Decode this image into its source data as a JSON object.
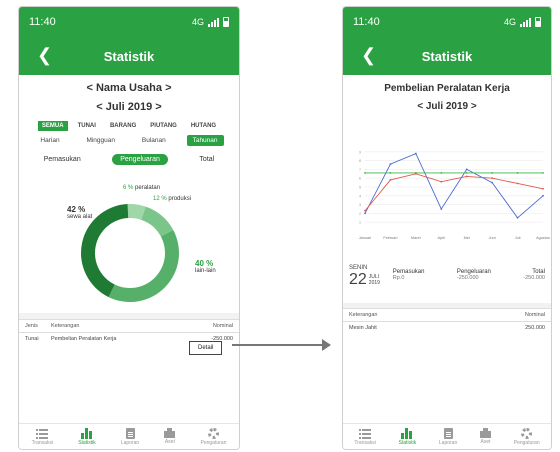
{
  "status": {
    "time": "11:40",
    "network": "4G"
  },
  "colors": {
    "brand_green": "#2aa142",
    "blue_line": "#4a6bd6",
    "red_line": "#e05a4a",
    "green_line": "#3db54a"
  },
  "screen1": {
    "title": "Statistik",
    "business_selector": "< Nama Usaha >",
    "month_selector": "< Juli 2019 >",
    "type_tabs": [
      "SEMUA",
      "TUNAI",
      "BARANG",
      "PIUTANG",
      "HUTANG"
    ],
    "period_filters": [
      "Harian",
      "Mingguan",
      "Bulanan",
      "Tahunan"
    ],
    "segments": [
      "Pemasukan",
      "Pengeluaran",
      "Total"
    ],
    "donut": {
      "slices": [
        {
          "label": "42 %",
          "sub": "sewa alat",
          "value": 42,
          "color": "#1f7a33"
        },
        {
          "label": "6 %",
          "sub": "peralatan",
          "value": 6,
          "color": "#9fd7a8"
        },
        {
          "label": "12 %",
          "sub": "produksi",
          "value": 12,
          "color": "#7cc58a"
        },
        {
          "label": "40 %",
          "sub": "lain-lain",
          "value": 40,
          "color": "#56b06a"
        }
      ]
    },
    "table": {
      "headers": [
        "Jenis",
        "Keterangan",
        "Nominal"
      ],
      "rows": [
        {
          "jenis": "Tunai",
          "keterangan": "Pembelian Peralatan Kerja",
          "nominal": "-250.000"
        }
      ]
    },
    "detail_button": "Detail"
  },
  "screen2": {
    "title": "Statistik",
    "heading": "Pembelian Peralatan Kerja",
    "month_selector": "< Juli 2019 >",
    "summary": {
      "day_label": "SENIN",
      "day": "22",
      "month_year": "JULI 2019",
      "cols": [
        {
          "label": "Pemasukan",
          "value": "Rp.0"
        },
        {
          "label": "Pengeluaran",
          "value": "-250.000"
        },
        {
          "label": "Total",
          "value": "-250.000"
        }
      ]
    },
    "table": {
      "headers": [
        "Keterangan",
        "Nominal"
      ],
      "rows": [
        {
          "keterangan": "Mesin Jahit",
          "nominal": "250.000"
        }
      ]
    }
  },
  "bottom_nav": [
    "Transaksi",
    "Statistik",
    "Laporan",
    "Aset",
    "Pengaturan"
  ],
  "chart_data": {
    "type": "line",
    "title": "",
    "x": [
      "Januari",
      "Februari",
      "Maret",
      "April",
      "Mei",
      "Juni",
      "Juli",
      "Agustus"
    ],
    "ylim": [
      0,
      10
    ],
    "yticks": [
      1,
      2,
      3,
      4,
      5,
      6,
      7,
      8,
      9
    ],
    "series": [
      {
        "name": "",
        "color": "#4a6bd6",
        "values": [
          2,
          7.6,
          8.8,
          2.5,
          7.0,
          5.5,
          1.5,
          4.0
        ]
      },
      {
        "name": "",
        "color": "#e05a4a",
        "values": [
          2.3,
          5.8,
          6.5,
          5.6,
          6.2,
          6.0,
          5.4,
          4.8
        ]
      },
      {
        "name": "",
        "color": "#3db54a",
        "values": [
          6.6,
          6.6,
          6.6,
          6.6,
          6.6,
          6.6,
          6.6,
          6.6
        ]
      }
    ]
  }
}
